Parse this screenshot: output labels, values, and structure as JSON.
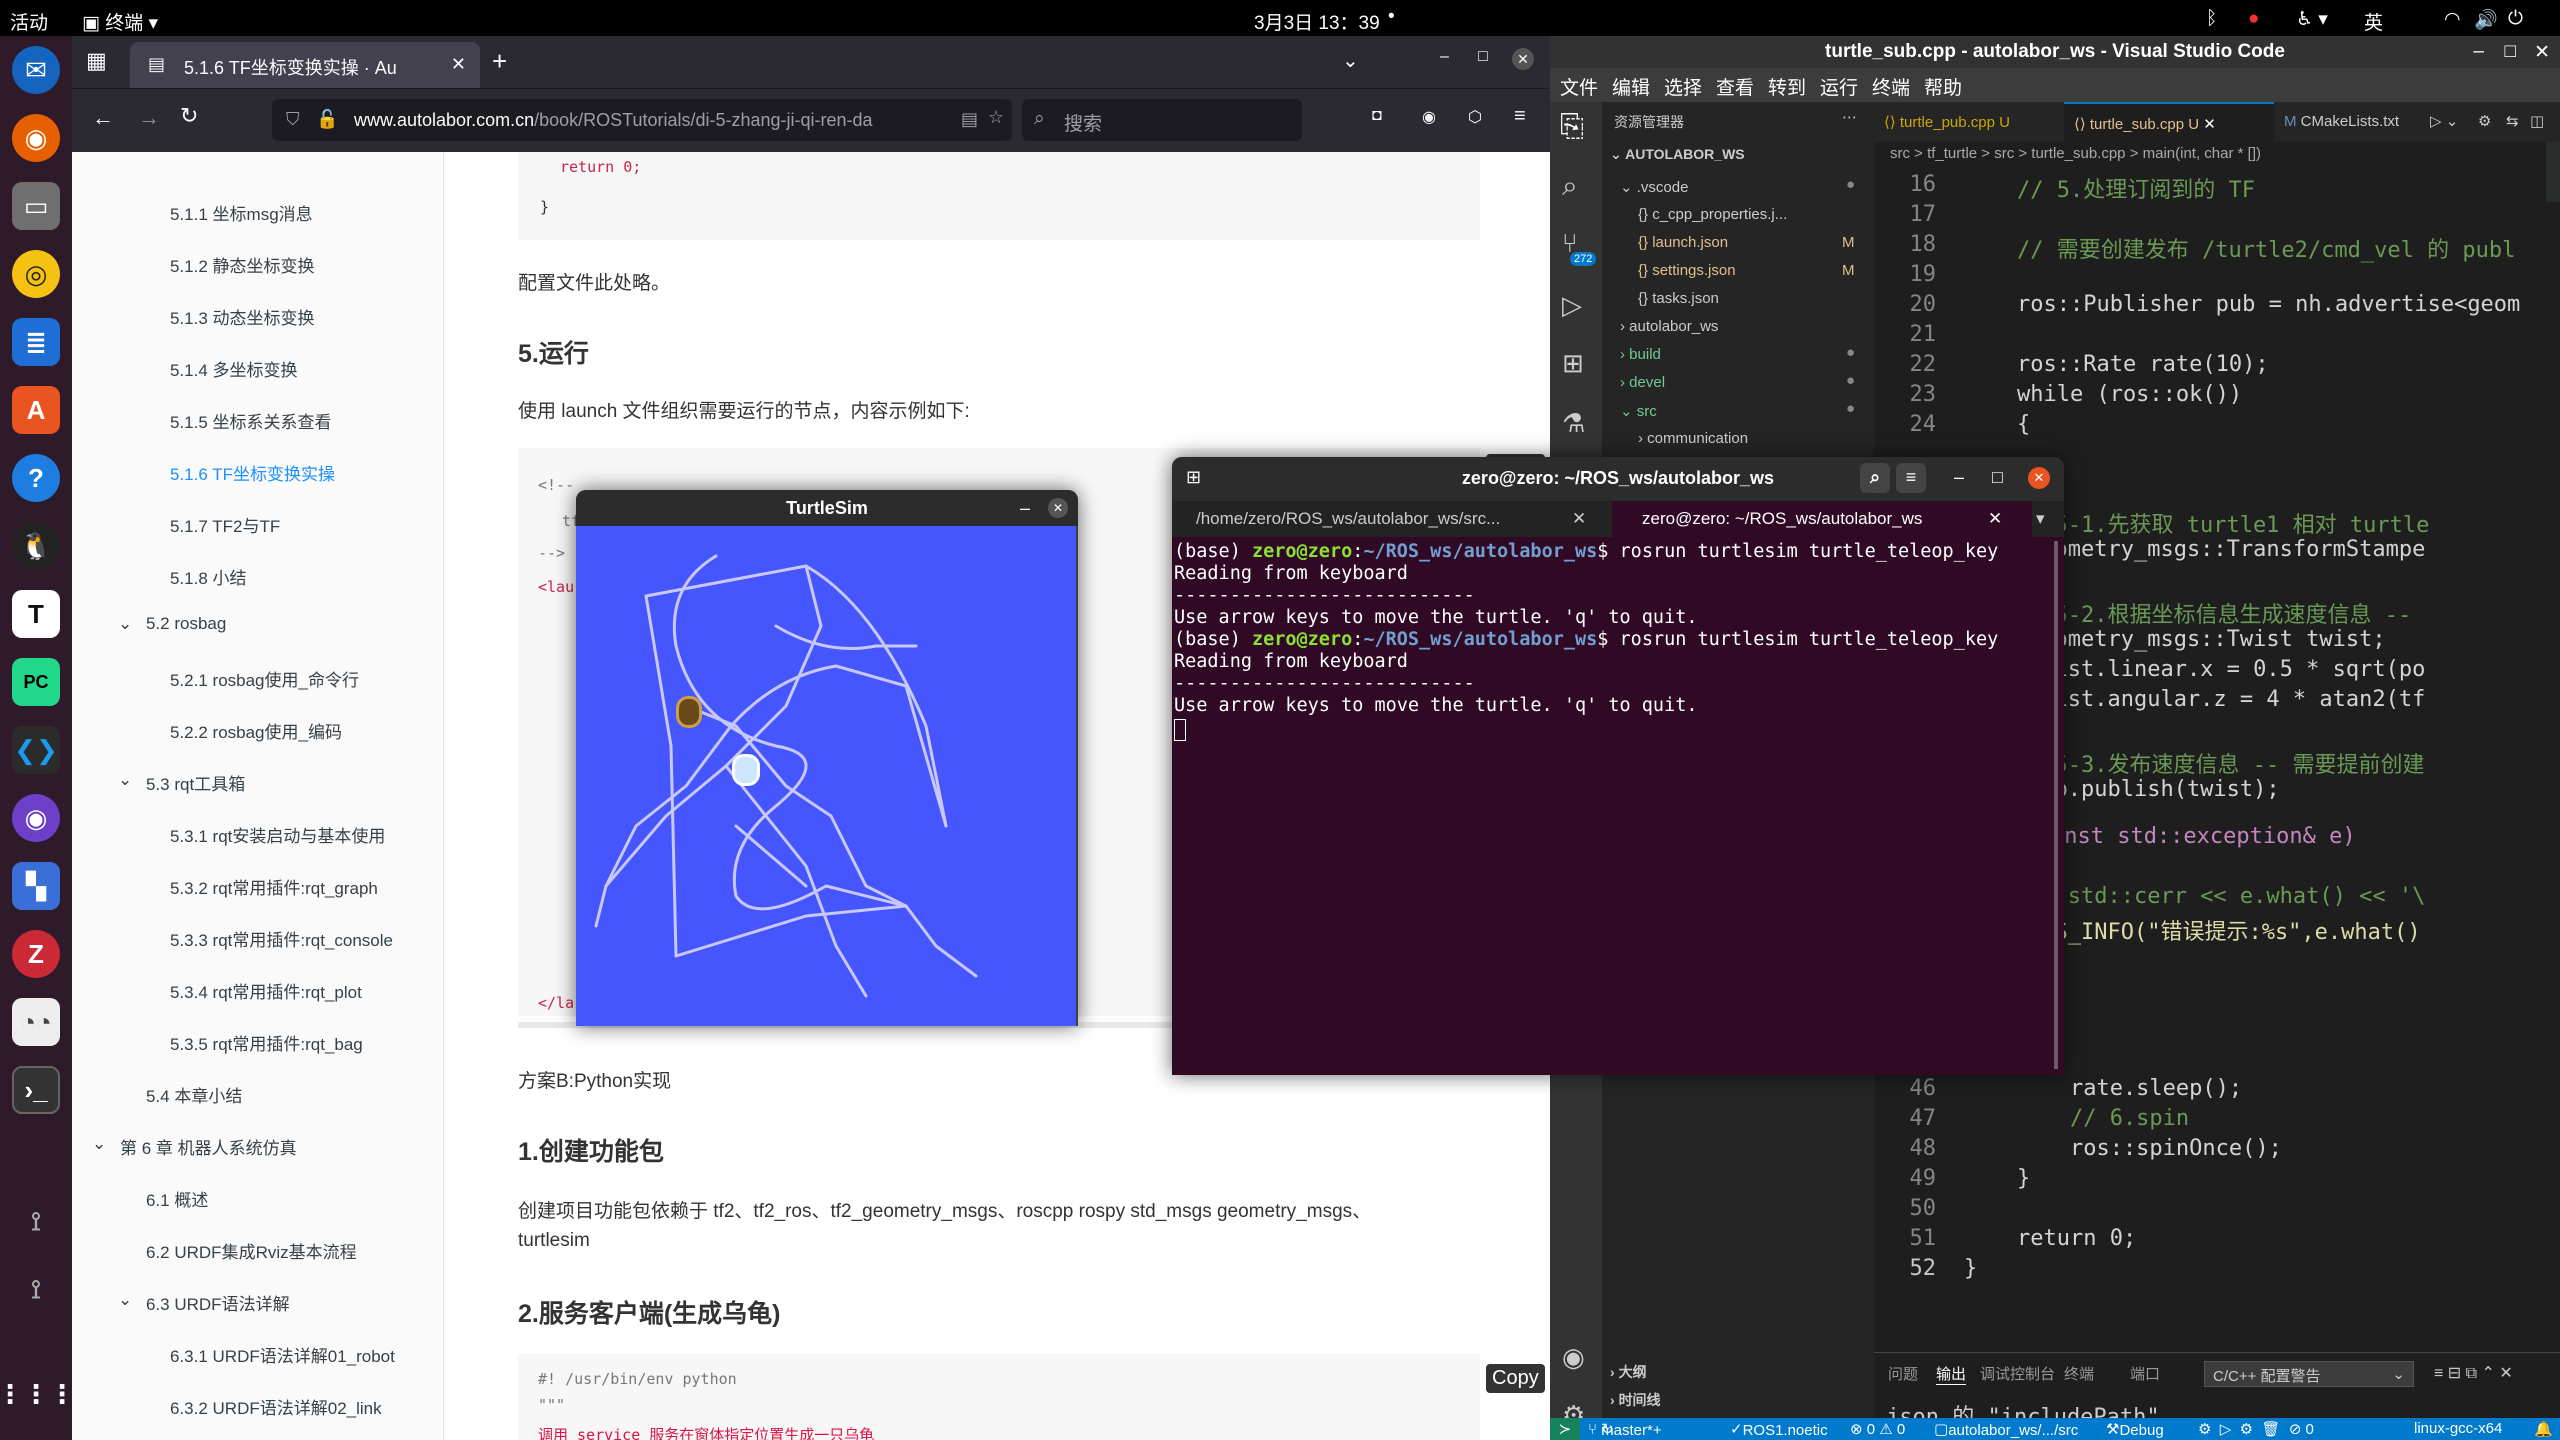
{
  "topbar": {
    "activities": "活动",
    "app": "终端",
    "datetime": "3月3日  13：39",
    "input_method": "英"
  },
  "dock": {
    "items": [
      "thunderbird-icon",
      "firefox-icon",
      "files-icon",
      "rhythmbox-icon",
      "writer-icon",
      "software-icon",
      "help-icon",
      "qq-icon",
      "typora-icon",
      "pycharm-icon",
      "vscode-icon",
      "github-icon",
      "app-icon",
      "zotero-icon",
      "reader-icon",
      "terminal-icon",
      "usb-icon",
      "usb-icon",
      "show-apps-icon"
    ],
    "typora_letter": "T",
    "pycharm_letter": "PC",
    "zotero_letter": "Z"
  },
  "browser": {
    "tab_title": "5.1.6 TF坐标变换实操 · Au",
    "url_domain": "www.autolabor.com.cn",
    "url_path": "/book/ROSTutorials/di-5-zhang-ji-qi-ren-da",
    "search_placeholder": "搜索",
    "toc": [
      "5.1.1 坐标msg消息",
      "5.1.2 静态坐标变换",
      "5.1.3 动态坐标变换",
      "5.1.4 多坐标变换",
      "5.1.5 坐标系关系查看",
      "5.1.6 TF坐标变换实操",
      "5.1.7 TF2与TF",
      "5.1.8 小结",
      "5.2 rosbag",
      "5.2.1 rosbag使用_命令行",
      "5.2.2 rosbag使用_编码",
      "5.3 rqt工具箱",
      "5.3.1 rqt安装启动与基本使用",
      "5.3.2 rqt常用插件:rqt_graph",
      "5.3.3 rqt常用插件:rqt_console",
      "5.3.4 rqt常用插件:rqt_plot",
      "5.3.5 rqt常用插件:rqt_bag",
      "5.4 本章小结",
      "第 6 章 机器人系统仿真",
      "6.1 概述",
      "6.2 URDF集成Rviz基本流程",
      "6.3 URDF语法详解",
      "6.3.1 URDF语法详解01_robot",
      "6.3.2 URDF语法详解02_link",
      "6.3.3 URDF语法详解03_joint"
    ],
    "content": {
      "code_top_1": "return 0;",
      "code_top_2": "}",
      "p_config": "配置文件此处略。",
      "h_run": "5.运行",
      "p_launch": "使用 launch 文件组织需要运行的节点，内容示例如下:",
      "copy": "Copy",
      "launch_code": [
        "<!--",
        "    tf2 实现小乌龟跟随案例",
        "-->",
        "<lau"
      ],
      "launch_frag": [
        "=\"turtle",
        "name=\"key",
        "rtle2\" na",
        "er\" name=\"",
        "er\" name=\"",
        "ener\" name",
        "</la"
      ],
      "p_python": "方案B:Python实现",
      "h_pkg": "1.创建功能包",
      "p_deps": "创建项目功能包依赖于 tf2、tf2_ros、tf2_geometry_msgs、roscpp rospy std_msgs geometry_msgs、",
      "p_deps2": "turtlesim",
      "h_srv": "2.服务客户端(生成乌龟)",
      "py_code": [
        "#! /usr/bin/env python",
        "\"\"\"",
        "    调用 service 服务在窗体指定位置生成一只乌龟"
      ]
    }
  },
  "turtlesim": {
    "title": "TurtleSim"
  },
  "terminal": {
    "title": "zero@zero: ~/ROS_ws/autolabor_ws",
    "tab1": "/home/zero/ROS_ws/autolabor_ws/src...",
    "tab2": "zero@zero: ~/ROS_ws/autolabor_ws",
    "lines": [
      {
        "pre": "(base) ",
        "user": "zero@zero",
        "sep": ":",
        "path": "~/ROS_ws/autolabor_ws",
        "cmd": "$ rosrun turtlesim turtle_teleop_key"
      },
      {
        "text": "Reading from keyboard"
      },
      {
        "text": "---------------------------"
      },
      {
        "text": "Use arrow keys to move the turtle. 'q' to quit."
      },
      {
        "pre": "(base) ",
        "user": "zero@zero",
        "sep": ":",
        "path": "~/ROS_ws/autolabor_ws",
        "cmd": "$ rosrun turtlesim turtle_teleop_key"
      },
      {
        "text": "Reading from keyboard"
      },
      {
        "text": "---------------------------"
      },
      {
        "text": "Use arrow keys to move the turtle. 'q' to quit."
      }
    ]
  },
  "vscode": {
    "title": "turtle_sub.cpp - autolabor_ws - Visual Studio Code",
    "menu": [
      "文件",
      "编辑",
      "选择",
      "查看",
      "转到",
      "运行",
      "终端",
      "帮助"
    ],
    "explorer_title": "资源管理器",
    "workspace": "AUTOLABOR_WS",
    "tree": [
      ".vscode",
      "c_cpp_properties.j...",
      "launch.json",
      "settings.json",
      "tasks.json",
      "autolabor_ws",
      "build",
      "devel",
      "src",
      "communication"
    ],
    "tree_badges": {
      "launch": "M",
      "settings": "M"
    },
    "scm_badge": "272",
    "tabs": [
      "turtle_pub.cpp",
      "turtle_sub.cpp",
      "CMakeLists.txt"
    ],
    "tab_flag": "U",
    "breadcrumb": "src  >  tf_turtle  >  src  >  turtle_sub.cpp  >  main(int, char * [])",
    "lines": [
      {
        "n": "16",
        "t": "    // 5.处理订阅到的 TF"
      },
      {
        "n": "17",
        "t": ""
      },
      {
        "n": "18",
        "t": "    // 需要创建发布 /turtle2/cmd_vel 的 publ"
      },
      {
        "n": "19",
        "t": ""
      },
      {
        "n": "20",
        "t": "    ros::Publisher pub = nh.advertise<geom"
      },
      {
        "n": "21",
        "t": ""
      },
      {
        "n": "22",
        "t": "    ros::Rate rate(10);"
      },
      {
        "n": "23",
        "t": "    while (ros::ok())"
      },
      {
        "n": "24",
        "t": "    {"
      }
    ],
    "lines_hidden": [
      "//5-1.先获取 turtle1 相对 turtle",
      "geometry_msgs::TransformStampe",
      "",
      "//5-2.根据坐标信息生成速度信息 --",
      "geometry_msgs::Twist twist;",
      "twist.linear.x = 0.5 * sqrt(po",
      "twist.angular.z = 4 * atan2(tf",
      "",
      "//5-3.发布速度信息 -- 需要提前创建",
      "pub.publish(twist);"
    ],
    "catch_line": "ch(const std::exception& e)",
    "cerr_line": "// std::cerr << e.what() << '\\",
    "rosinfo_line": "ROS_INFO(\"错误提示:%s\",e.what()",
    "lines_bottom": [
      {
        "n": "46",
        "t": "        rate.sleep();"
      },
      {
        "n": "47",
        "t": "        // 6.spin"
      },
      {
        "n": "48",
        "t": "        ros::spinOnce();"
      },
      {
        "n": "49",
        "t": "    }"
      },
      {
        "n": "50",
        "t": ""
      },
      {
        "n": "51",
        "t": "    return 0;"
      },
      {
        "n": "52",
        "t": "}"
      }
    ],
    "panel_tabs": [
      "问题",
      "输出",
      "调试控制台",
      "终端",
      "端口"
    ],
    "panel_select": "C/C++ 配置警告",
    "panel_text": "json 的 \"includePath\"。",
    "outline": "大纲",
    "timeline": "时间线",
    "status": [
      "master*+",
      "ROS1.noetic",
      "⊗ 0 ⚠ 0",
      "autolabor_ws/.../src",
      "Debug",
      "linux-gcc-x64"
    ]
  },
  "colors": {
    "vscode_blue": "#007acc",
    "terminal_bg": "#300a24",
    "turtle_bg": "#4556ff",
    "link_blue": "#1e90ff"
  }
}
